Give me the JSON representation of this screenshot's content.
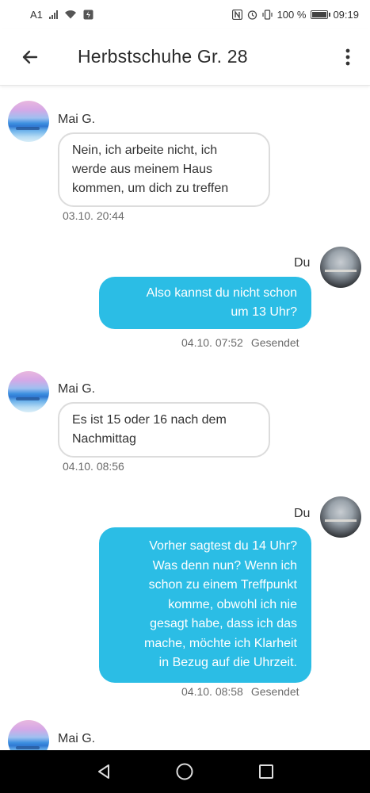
{
  "status_bar": {
    "carrier": "A1",
    "battery_text": "100 %",
    "time": "09:19"
  },
  "header": {
    "title": "Herbstschuhe Gr. 28",
    "back_icon": "arrow-left-icon",
    "more_icon": "more-vertical-icon"
  },
  "messages": [
    {
      "direction": "incoming",
      "sender": "Mai G.",
      "lines": [
        "Nein, ich arbeite nicht, ich",
        "werde aus meinem Haus",
        "kommen, um dich zu treffen"
      ],
      "timestamp": "03.10. 20:44"
    },
    {
      "direction": "outgoing",
      "sender": "Du",
      "lines": [
        "Also kannst du nicht schon",
        "um 13 Uhr?"
      ],
      "timestamp": "04.10. 07:52",
      "status": "Gesendet"
    },
    {
      "direction": "incoming",
      "sender": "Mai G.",
      "lines": [
        "Es ist 15 oder 16 nach dem",
        "Nachmittag"
      ],
      "timestamp": "04.10. 08:56"
    },
    {
      "direction": "outgoing",
      "sender": "Du",
      "lines": [
        "Vorher sagtest du 14 Uhr?",
        "Was denn nun? Wenn ich",
        "schon zu einem Treffpunkt",
        "komme, obwohl ich nie",
        "gesagt habe, dass ich das",
        "mache, möchte ich Klarheit",
        "in Bezug auf die Uhrzeit."
      ],
      "timestamp": "04.10. 08:58",
      "status": "Gesendet"
    },
    {
      "direction": "incoming",
      "sender": "Mai G."
    }
  ],
  "colors": {
    "outgoing_bubble": "#2bbde5",
    "incoming_border": "#dcdcdc",
    "nav_bar": "#000000"
  },
  "nav": {
    "back": "triangle-back-icon",
    "home": "circle-home-icon",
    "recents": "square-recents-icon"
  }
}
